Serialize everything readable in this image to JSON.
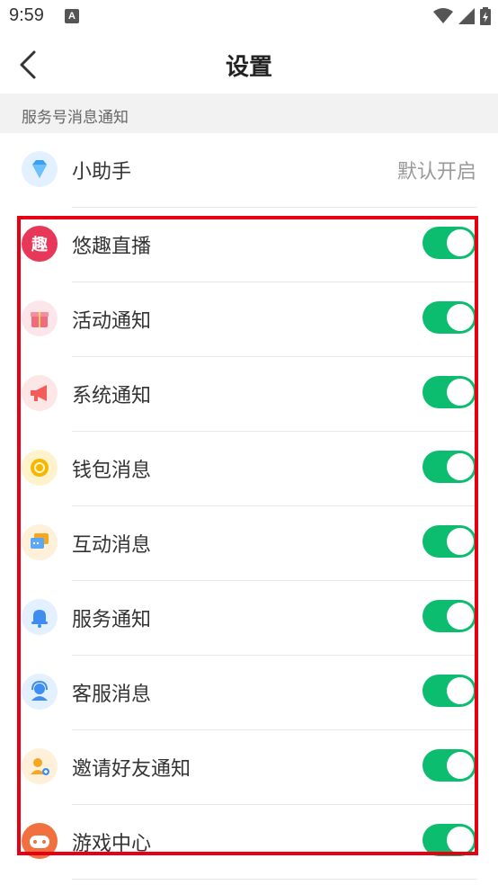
{
  "status_bar": {
    "time": "9:59",
    "notification_letter": "A"
  },
  "header": {
    "title": "设置"
  },
  "section": {
    "label": "服务号消息通知"
  },
  "assistant": {
    "label": "小助手",
    "status": "默认开启",
    "icon": "diamond-icon"
  },
  "items": [
    {
      "label": "悠趣直播",
      "icon": "youqu-live-icon",
      "icon_color": "#e8385a",
      "enabled": true
    },
    {
      "label": "活动通知",
      "icon": "gift-icon",
      "icon_color": "#f06a80",
      "enabled": true
    },
    {
      "label": "系统通知",
      "icon": "megaphone-icon",
      "icon_color": "#f45b5b",
      "enabled": true
    },
    {
      "label": "钱包消息",
      "icon": "coin-icon",
      "icon_color": "#f5b800",
      "enabled": true
    },
    {
      "label": "互动消息",
      "icon": "chat-icon",
      "icon_color": "#f5a623",
      "enabled": true
    },
    {
      "label": "服务通知",
      "icon": "bell-icon",
      "icon_color": "#3d8ef0",
      "enabled": true
    },
    {
      "label": "客服消息",
      "icon": "customer-service-icon",
      "icon_color": "#3d8ef0",
      "enabled": true
    },
    {
      "label": "邀请好友通知",
      "icon": "invite-friend-icon",
      "icon_color": "#f5a623",
      "enabled": true
    },
    {
      "label": "游戏中心",
      "icon": "gamepad-icon",
      "icon_color": "#f07040",
      "enabled": true
    }
  ],
  "colors": {
    "toggle_on": "#0cbd70",
    "highlight": "#e60012"
  }
}
